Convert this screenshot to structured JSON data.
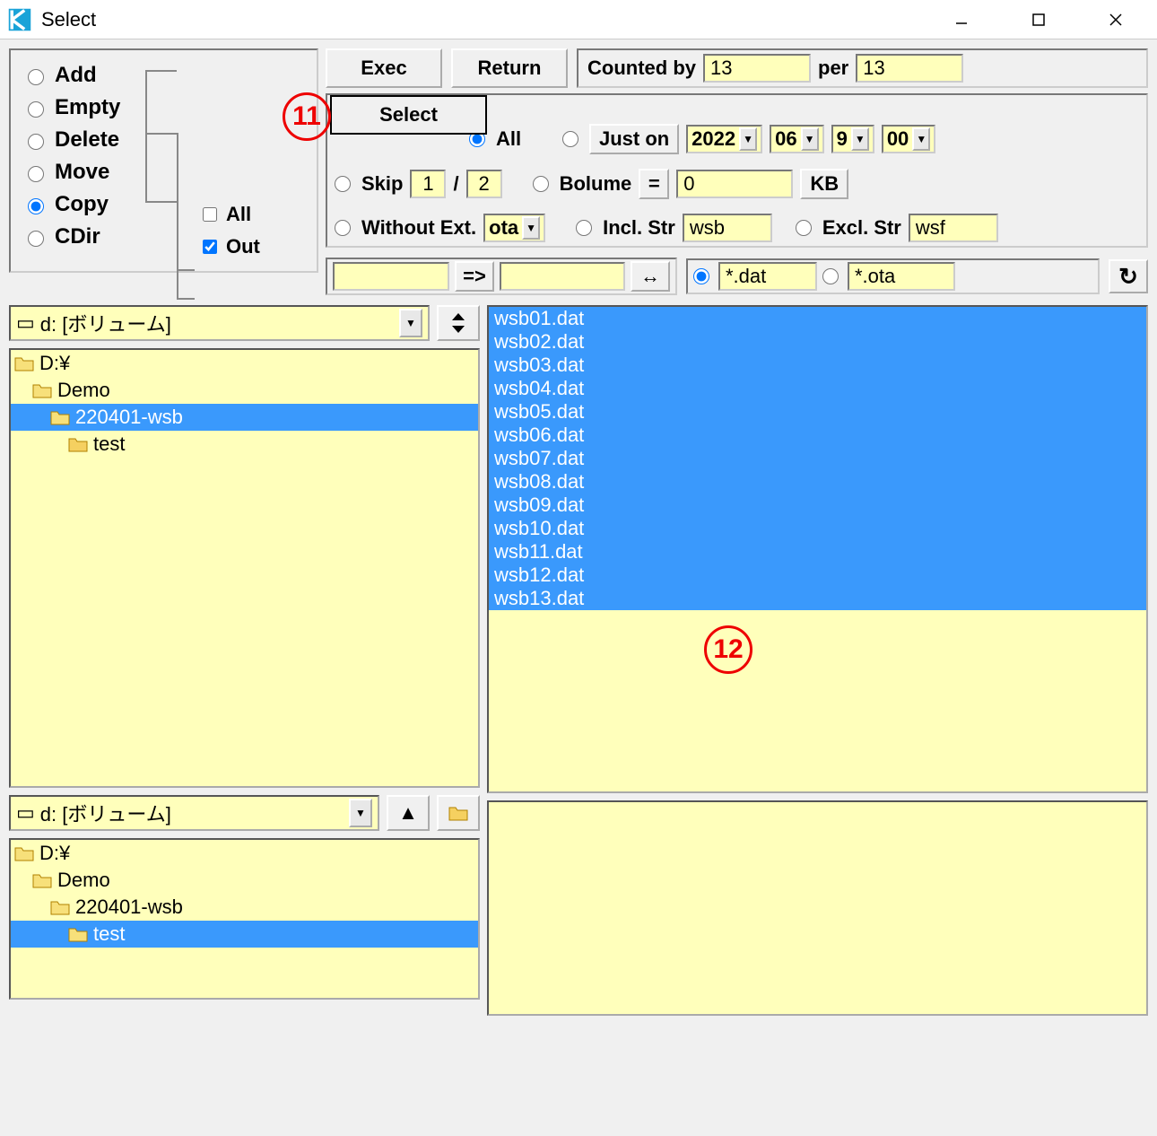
{
  "window": {
    "title": "Select"
  },
  "annotations": {
    "a11": "11",
    "a12": "12"
  },
  "opPanel": {
    "items": [
      "Add",
      "Empty",
      "Delete",
      "Move",
      "Copy",
      "CDir"
    ],
    "selectedIndex": 4,
    "allLabel": "All",
    "allChecked": false,
    "outLabel": "Out",
    "outChecked": true
  },
  "topButtons": {
    "exec": "Exec",
    "return": "Return",
    "select": "Select"
  },
  "counted": {
    "label": "Counted by",
    "value": "13",
    "perLabel": "per",
    "perValue": "13"
  },
  "filter": {
    "allLabel": "All",
    "justOnLabel": "Just on",
    "justOn": {
      "year": "2022",
      "month": "06",
      "day": "9",
      "hour": "00"
    },
    "skipLabel": "Skip",
    "skipA": "1",
    "skipSlash": "/",
    "skipB": "2",
    "bolumeLabel": "Bolume",
    "bolumeEq": "=",
    "bolumeVal": "0",
    "bolumeUnit": "KB",
    "withoutLabel": "Without Ext.",
    "withoutVal": "ota",
    "inclLabel": "Incl. Str",
    "inclVal": "wsb",
    "exclLabel": "Excl. Str",
    "exclVal": "wsf"
  },
  "strRow": {
    "arrowRight": "=>",
    "swap": "↔",
    "patternA": "*.dat",
    "patternB": "*.ota",
    "refresh": "↻"
  },
  "driveTop": {
    "text": "d: [ボリューム]",
    "items": [
      "D:¥",
      "Demo",
      "220401-wsb",
      "test"
    ],
    "selectedIndex": 2
  },
  "driveBottom": {
    "text": "d: [ボリューム]",
    "items": [
      "D:¥",
      "Demo",
      "220401-wsb",
      "test"
    ],
    "selectedIndex": 3
  },
  "fileList": [
    "wsb01.dat",
    "wsb02.dat",
    "wsb03.dat",
    "wsb04.dat",
    "wsb05.dat",
    "wsb06.dat",
    "wsb07.dat",
    "wsb08.dat",
    "wsb09.dat",
    "wsb10.dat",
    "wsb11.dat",
    "wsb12.dat",
    "wsb13.dat"
  ]
}
